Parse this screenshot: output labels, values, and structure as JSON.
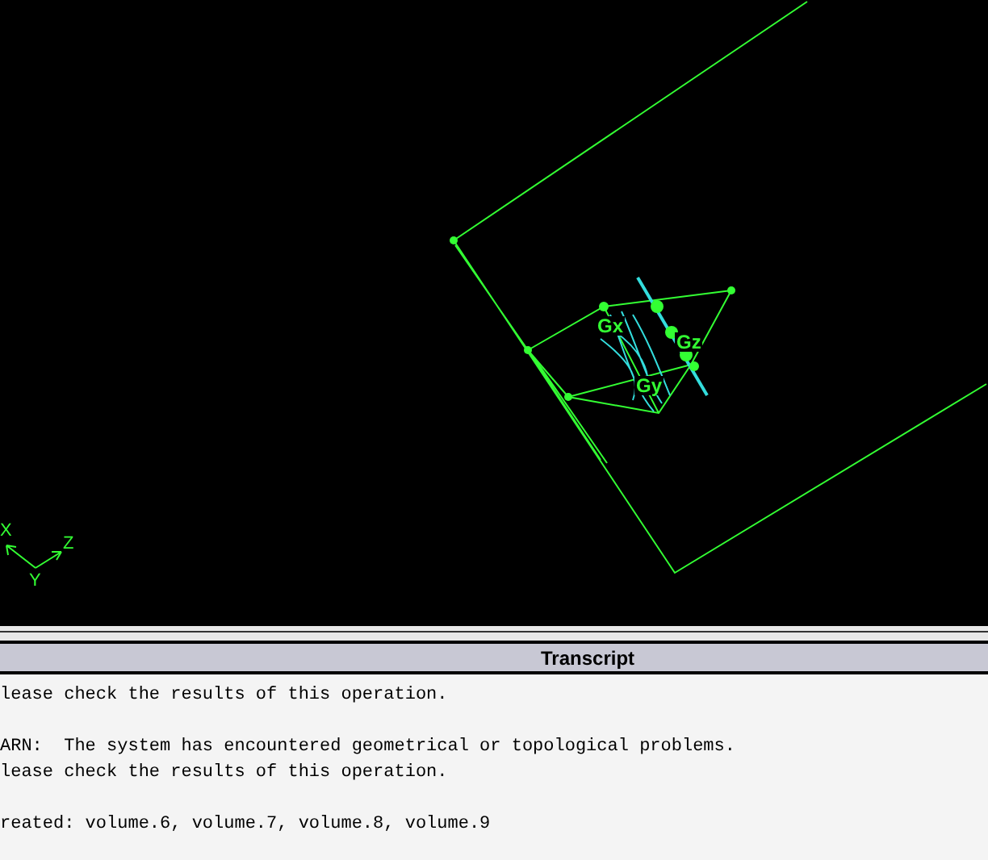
{
  "viewport": {
    "labels": [
      "Gx",
      "Gz",
      "Gy"
    ],
    "axes": [
      "X",
      "Y",
      "Z"
    ]
  },
  "transcript": {
    "title": "Transcript",
    "paragraphs": [
      [
        "lease check the results of this operation."
      ],
      [
        "ARN:  The system has encountered geometrical or topological problems.",
        "lease check the results of this operation."
      ],
      [
        "reated: volume.6, volume.7, volume.8, volume.9"
      ]
    ]
  }
}
